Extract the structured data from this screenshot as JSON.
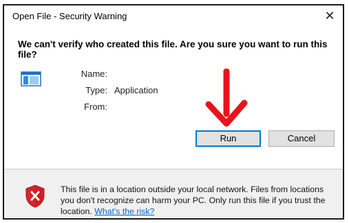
{
  "window": {
    "title": "Open File - Security Warning",
    "close_label": "✕"
  },
  "main": {
    "heading": "We can't verify who created this file. Are you sure you want to run this file?",
    "fields": [
      {
        "label": "Name:",
        "value": ""
      },
      {
        "label": "Type:",
        "value": "Application"
      },
      {
        "label": "From:",
        "value": ""
      }
    ]
  },
  "buttons": {
    "run": "Run",
    "cancel": "Cancel"
  },
  "footer": {
    "warning_text": "This file is in a location outside your local network. Files from locations you don't recognize can harm your PC. Only run this file if you trust the location.",
    "link_text": "What's the risk?"
  },
  "colors": {
    "accent": "#0078d7",
    "arrow": "#e8141c",
    "shield": "#d4252b",
    "link": "#0066cc"
  },
  "icons": [
    "application-icon",
    "red-arrow-annotation",
    "shield-warning-icon",
    "close-icon"
  ]
}
